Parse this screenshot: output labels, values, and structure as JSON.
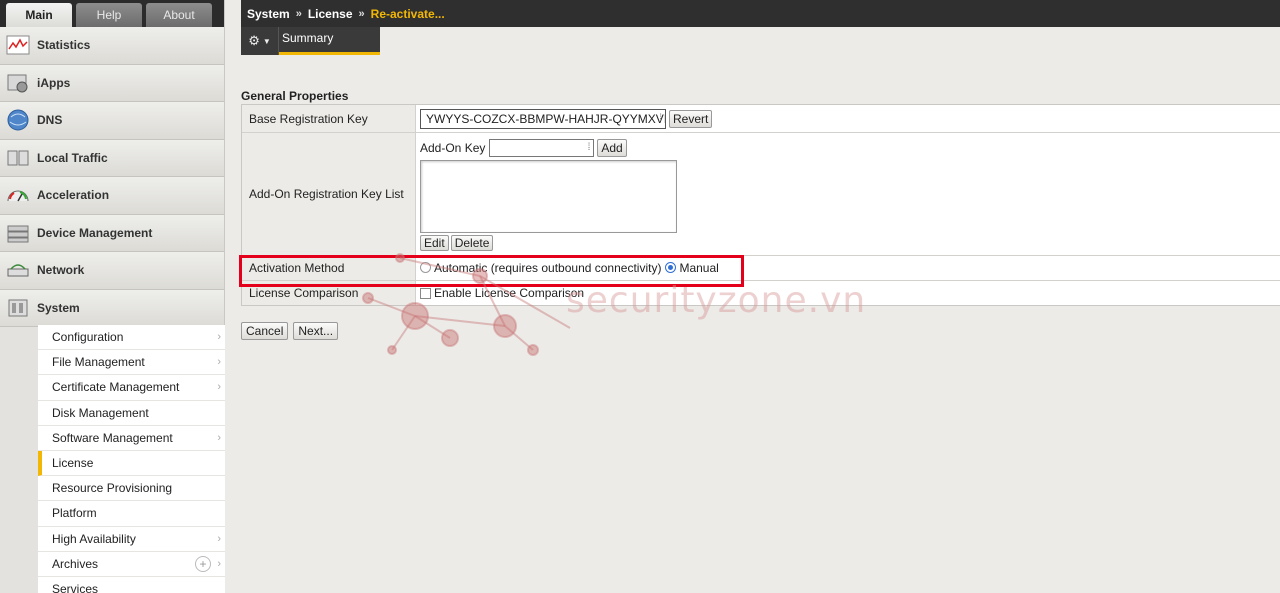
{
  "tabs": [
    {
      "label": "Main"
    },
    {
      "label": "Help"
    },
    {
      "label": "About"
    }
  ],
  "nav": [
    {
      "label": "Statistics",
      "icon": "statistics-icon"
    },
    {
      "label": "iApps",
      "icon": "iapps-icon"
    },
    {
      "label": "DNS",
      "icon": "dns-globe-icon"
    },
    {
      "label": "Local Traffic",
      "icon": "local-traffic-icon"
    },
    {
      "label": "Acceleration",
      "icon": "acceleration-gauge-icon"
    },
    {
      "label": "Device Management",
      "icon": "device-management-icon"
    },
    {
      "label": "Network",
      "icon": "network-icon"
    },
    {
      "label": "System",
      "icon": "system-icon"
    }
  ],
  "submenu": [
    {
      "label": "Configuration",
      "chevron": true
    },
    {
      "label": "File Management",
      "chevron": true
    },
    {
      "label": "Certificate Management",
      "chevron": true
    },
    {
      "label": "Disk Management",
      "chevron": false
    },
    {
      "label": "Software Management",
      "chevron": true
    },
    {
      "label": "License",
      "chevron": false,
      "selected": true
    },
    {
      "label": "Resource Provisioning",
      "chevron": false
    },
    {
      "label": "Platform",
      "chevron": false
    },
    {
      "label": "High Availability",
      "chevron": true
    },
    {
      "label": "Archives",
      "chevron": true,
      "plus": true
    },
    {
      "label": "Services",
      "chevron": false
    }
  ],
  "breadcrumb": {
    "items": [
      "System",
      "License",
      "Re-activate..."
    ],
    "separator": "»"
  },
  "subtabs": {
    "gear_icon": "gear-icon",
    "summary": "Summary"
  },
  "section_title": "General Properties",
  "properties": {
    "base_key_label": "Base Registration Key",
    "base_key_value": "YWYYS-COZCX-BBMPW-HAHJR-QYYMXVI",
    "revert_label": "Revert",
    "addon_list_label": "Add-On Registration Key List",
    "addon_key_label": "Add-On Key",
    "addon_key_value": "",
    "add_label": "Add",
    "edit_label": "Edit",
    "delete_label": "Delete",
    "activation_label": "Activation Method",
    "activation_automatic": "Automatic (requires outbound connectivity)",
    "activation_manual": "Manual",
    "activation_selected": "Manual",
    "license_comparison_label": "License Comparison",
    "enable_comparison": "Enable License Comparison",
    "enable_comparison_checked": false
  },
  "actions": {
    "cancel": "Cancel",
    "next": "Next..."
  },
  "watermark": "securityzone.vn",
  "colors": {
    "accent": "#f2b705",
    "highlight": "#e4001b",
    "header_bg": "#2f2f2f"
  }
}
